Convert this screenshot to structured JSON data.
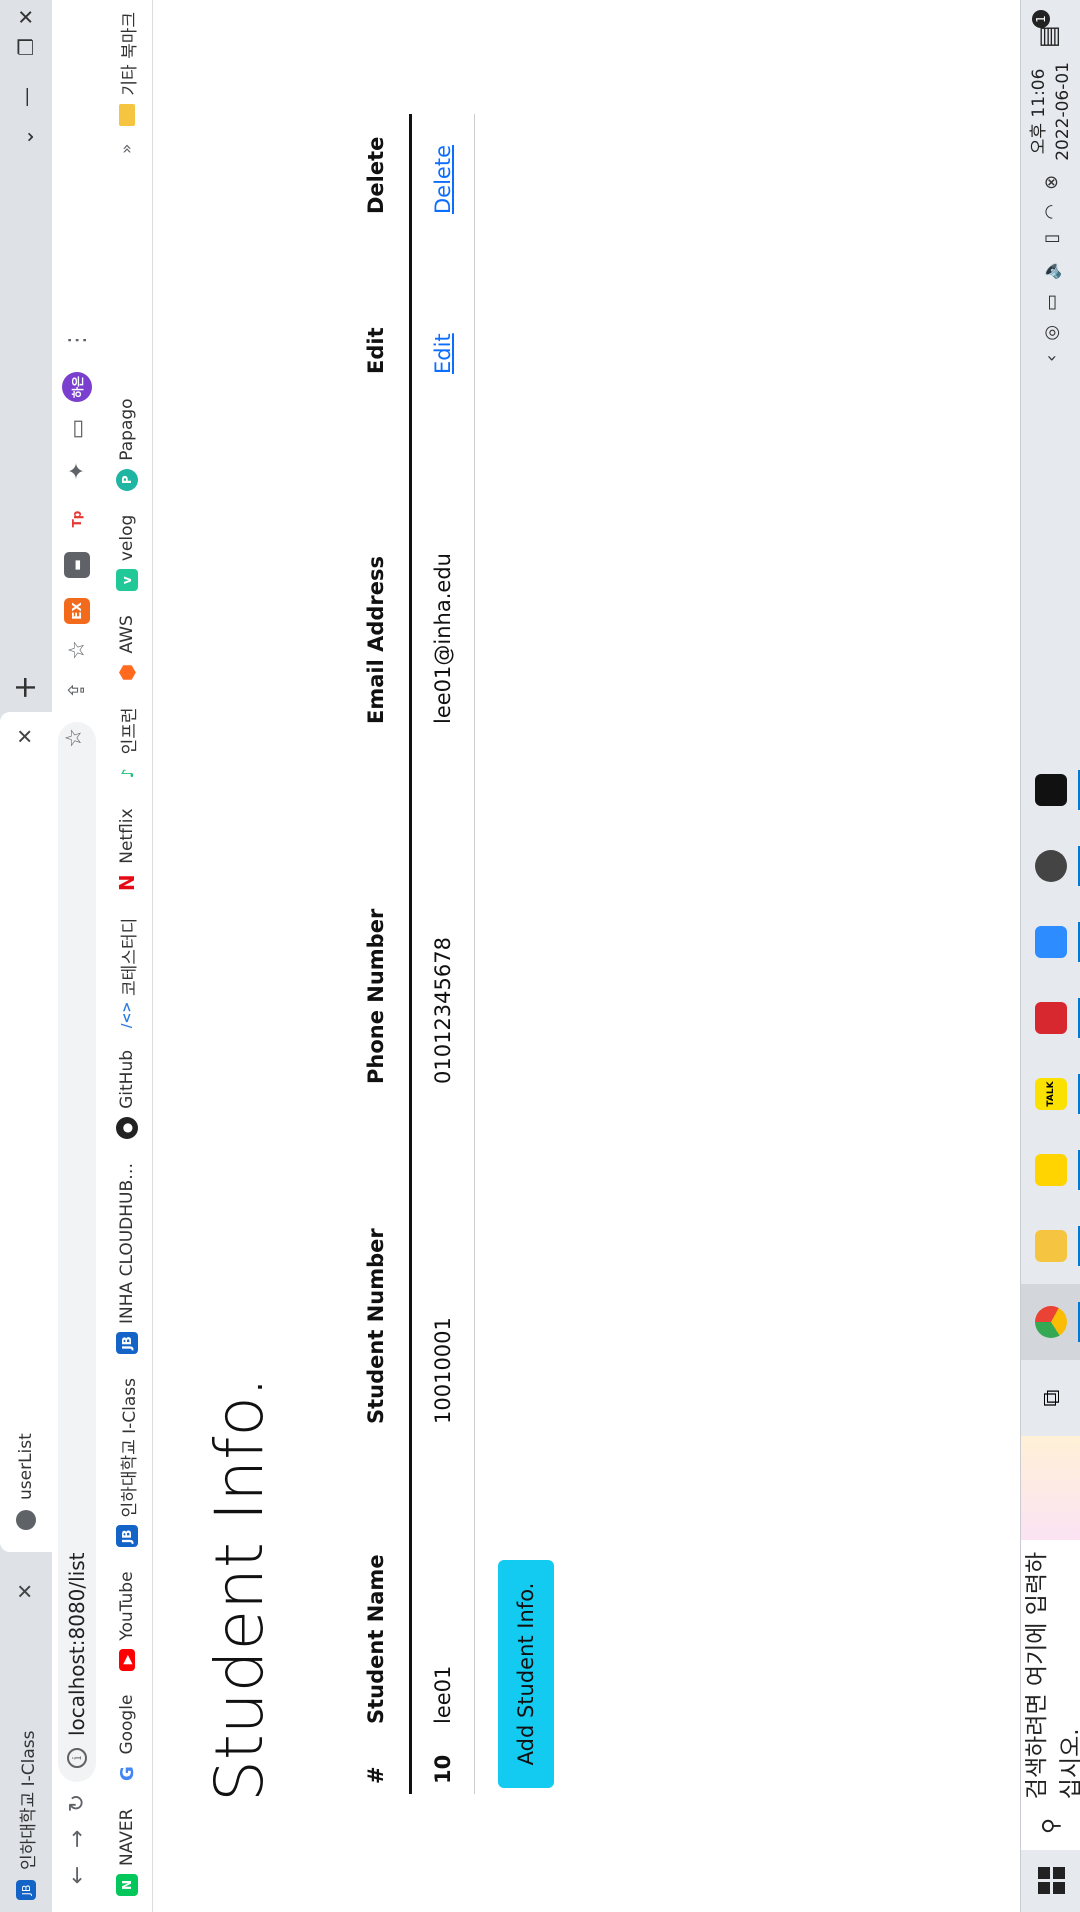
{
  "browser": {
    "tabs": [
      {
        "title": "인하대학교 I-Class",
        "active": false
      },
      {
        "title": "userList",
        "active": true
      }
    ],
    "url": "localhost:8080/list",
    "profile_label": "하은"
  },
  "bookmarks": [
    {
      "label": "NAVER",
      "icon": "naver-icon",
      "color": "#03c75a",
      "glyph": "N"
    },
    {
      "label": "Google",
      "icon": "google-icon",
      "color": "#4285f4",
      "glyph": "G"
    },
    {
      "label": "YouTube",
      "icon": "youtube-icon",
      "color": "#ff0000",
      "glyph": "▶"
    },
    {
      "label": "인하대학교 I-Class",
      "icon": "iclass-icon",
      "color": "#1463c7",
      "glyph": "JB"
    },
    {
      "label": "INHA CLOUDHUB…",
      "icon": "cloudhub-icon",
      "color": "#1463c7",
      "glyph": "JB"
    },
    {
      "label": "GitHub",
      "icon": "github-icon",
      "color": "#222222",
      "glyph": "●"
    },
    {
      "label": "코테스터디",
      "icon": "code-icon",
      "color": "#2a7de1",
      "glyph": "/<>"
    },
    {
      "label": "Netflix",
      "icon": "netflix-icon",
      "color": "#e50914",
      "glyph": "N"
    },
    {
      "label": "인프런",
      "icon": "inflearn-icon",
      "color": "#1dc078",
      "glyph": "♪"
    },
    {
      "label": "AWS",
      "icon": "aws-icon",
      "color": "#ff6a1f",
      "glyph": "⬢"
    },
    {
      "label": "velog",
      "icon": "velog-icon",
      "color": "#20c997",
      "glyph": "v"
    },
    {
      "label": "Papago",
      "icon": "papago-icon",
      "color": "#1fb5a3",
      "glyph": "P"
    }
  ],
  "other_bookmarks": "기타 북마크",
  "page": {
    "title": "Student Info.",
    "table": {
      "headers": [
        "#",
        "Student Name",
        "Student Number",
        "Phone Number",
        "Email Address",
        "Edit",
        "Delete"
      ],
      "rows": [
        {
          "id": "10",
          "name": "lee01",
          "number": "10010001",
          "phone": "01012345678",
          "email": "lee01@inha.edu",
          "edit": "Edit",
          "delete": "Delete"
        }
      ]
    },
    "add_button": "Add Student Info."
  },
  "taskbar": {
    "search_placeholder": "검색하려면 여기에 입력하십시오.",
    "time": "오후 11:06",
    "date": "2022-06-01",
    "notification_count": "1"
  }
}
